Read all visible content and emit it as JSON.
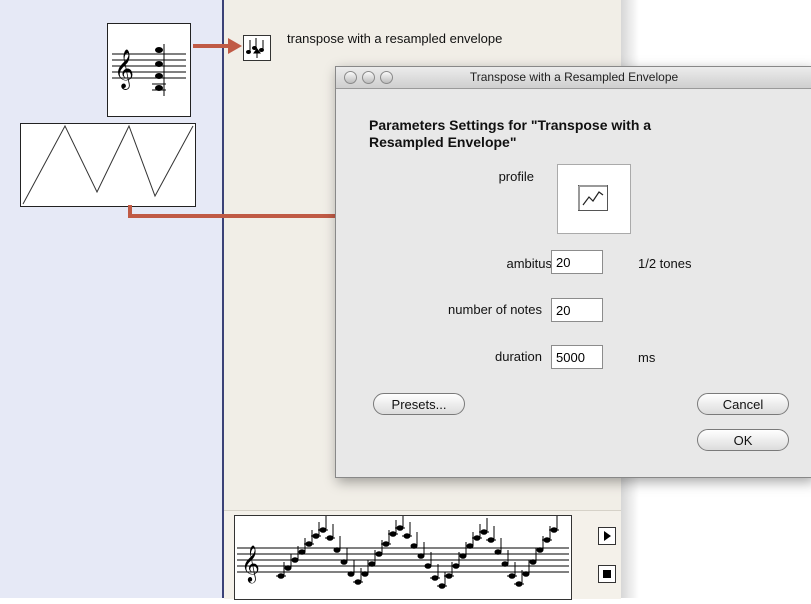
{
  "window": {
    "operator_label": "transpose with a resampled envelope"
  },
  "dialog": {
    "title": "Transpose with a Resampled Envelope",
    "heading_line1": "Parameters Settings for \"Transpose with a",
    "heading_line2": "Resampled Envelope\"",
    "profile": {
      "label": "profile",
      "icon": "curve-icon"
    },
    "ambitus": {
      "label": "ambitus",
      "value": "20",
      "unit": "1/2 tones"
    },
    "notes": {
      "label": "number of notes",
      "value": "20"
    },
    "duration": {
      "label": "duration",
      "value": "5000",
      "unit": "ms"
    },
    "buttons": {
      "presets": "Presets...",
      "cancel": "Cancel",
      "ok": "OK"
    }
  },
  "colors": {
    "arrow": "#c05a45",
    "left_panel": "#e6e9f6",
    "right_panel": "#f1eee7",
    "divider": "#3b4277"
  },
  "icons": {
    "op": "transpose-operator-icon",
    "play": "play-icon",
    "stop": "stop-icon",
    "staff": "treble-clef-staff-icon"
  }
}
